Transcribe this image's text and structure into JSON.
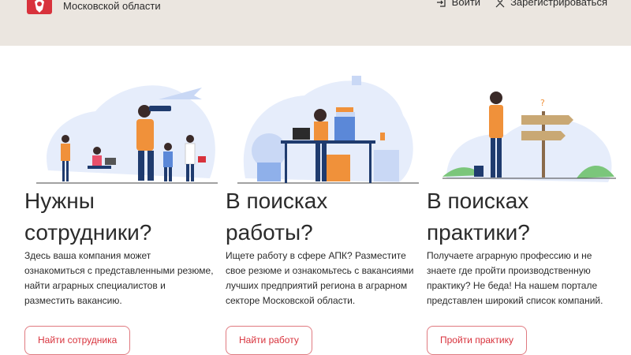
{
  "header": {
    "org_name": "Московской области",
    "login_label": "Войти",
    "register_label": "Зарегистрироваться"
  },
  "cards": [
    {
      "title_line1": "Нужны",
      "title_line2": "сотрудники?",
      "description": "Здесь ваша компания может ознакомиться с представленными резюме, найти аграрных специалистов и разместить вакансию.",
      "button_label": "Найти сотрудника"
    },
    {
      "title_line1": "В поисках",
      "title_line2": "работы?",
      "description": "Ищете работу в сфере АПК? Разместите свое резюме и ознакомьтесь с вакансиями лучших предприятий региона в аграрном секторе Московской области.",
      "button_label": "Найти работу"
    },
    {
      "title_line1": "В поисках",
      "title_line2": "практики?",
      "description": "Получаете аграрную профессию и не знаете где пройти производственную практику? Не беда! На нашем портале представлен широкий список компаний.",
      "button_label": "Пройти практику"
    }
  ],
  "colors": {
    "header_bg": "#ebe6e0",
    "accent": "#d8323c",
    "illustration_blue": "#c9d8f5",
    "illustration_orange": "#f0913a",
    "illustration_navy": "#1f3b6e"
  },
  "icons": {
    "logo": "coat-of-arms-icon",
    "login": "login-icon",
    "register": "user-icon"
  }
}
